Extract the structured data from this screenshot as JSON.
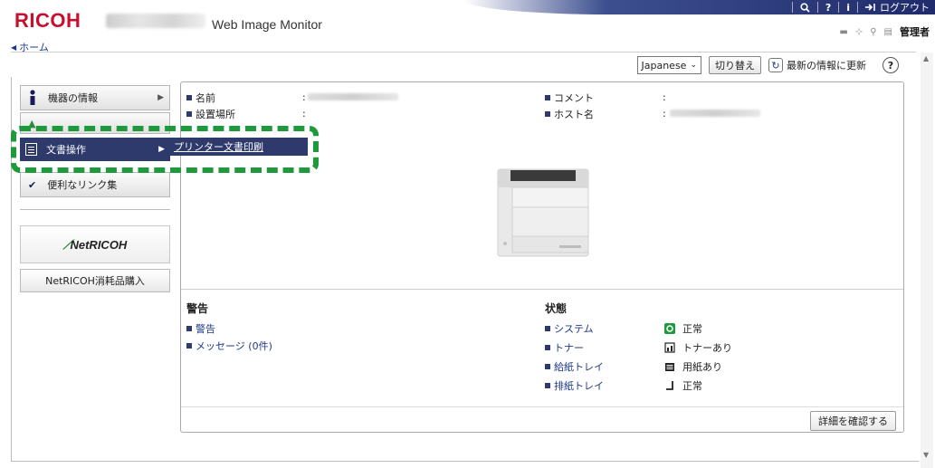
{
  "header": {
    "brand": "RICOH",
    "app_title": "Web Image Monitor",
    "nav": {
      "search_icon": "search-icon",
      "help_icon_label": "?",
      "info_icon_label": "i",
      "logout_label": "ログアウト"
    },
    "user_label": "管理者"
  },
  "breadcrumb": {
    "home_label": "ホーム"
  },
  "toolbar": {
    "language_value": "Japanese",
    "switch_label": "切り替え",
    "refresh_label": "最新の情報に更新",
    "help_label": "?"
  },
  "sidebar": {
    "items": [
      {
        "label": "機器の情報",
        "icon": "info-icon"
      },
      {
        "label": "文書操作",
        "icon": "document-icon"
      },
      {
        "label": "便利なリンク集",
        "icon": "check-icon"
      }
    ],
    "submenu": {
      "label": "プリンター文書印刷"
    },
    "netricoh_logo": "NetRICOH",
    "netricoh_link": "NetRICOH消耗品購入"
  },
  "device_info": {
    "name_label": "名前",
    "location_label": "設置場所",
    "comment_label": "コメント",
    "host_label": "ホスト名",
    "colon": ":"
  },
  "alerts": {
    "title": "警告",
    "items": [
      "警告",
      "メッセージ (0件)"
    ]
  },
  "status": {
    "title": "状態",
    "rows": [
      {
        "label": "システム",
        "value": "正常",
        "icon": "system-ok-icon"
      },
      {
        "label": "トナー",
        "value": "トナーあり",
        "icon": "toner-icon"
      },
      {
        "label": "給紙トレイ",
        "value": "用紙あり",
        "icon": "paper-tray-icon"
      },
      {
        "label": "排紙トレイ",
        "value": "正常",
        "icon": "output-tray-icon"
      }
    ]
  },
  "detail_button": "詳細を確認する",
  "colors": {
    "brand_red": "#c8102e",
    "navy": "#2d3a6b",
    "highlight_green": "#1e9a3c",
    "link_blue": "#1f3a8a"
  }
}
